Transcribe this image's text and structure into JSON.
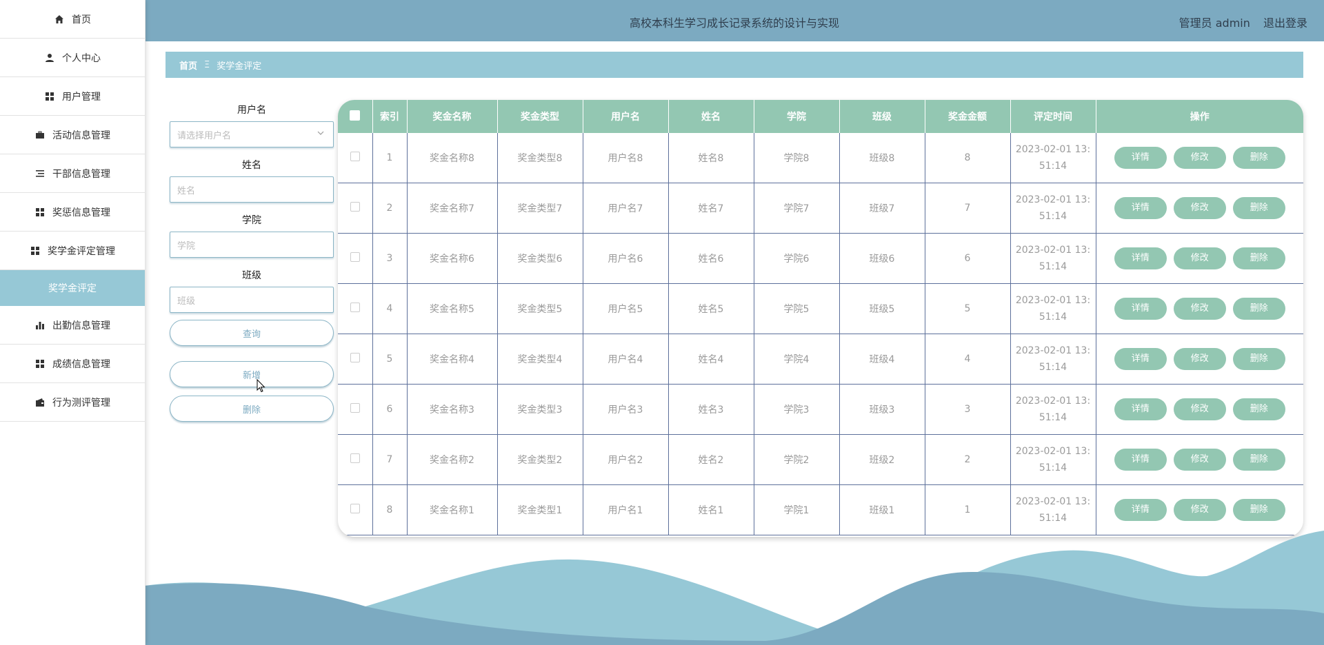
{
  "header": {
    "title": "高校本科生学习成长记录系统的设计与实现",
    "user_label": "管理员 admin",
    "logout": "退出登录"
  },
  "sidebar": {
    "items": [
      {
        "label": "首页",
        "icon": "home-icon"
      },
      {
        "label": "个人中心",
        "icon": "person-icon"
      },
      {
        "label": "用户管理",
        "icon": "grid-icon"
      },
      {
        "label": "活动信息管理",
        "icon": "briefcase-icon"
      },
      {
        "label": "干部信息管理",
        "icon": "list-icon"
      },
      {
        "label": "奖惩信息管理",
        "icon": "grid-icon"
      },
      {
        "label": "奖学金评定管理",
        "icon": "grid-icon"
      },
      {
        "label": "奖学金评定",
        "icon": ""
      },
      {
        "label": "出勤信息管理",
        "icon": "bar-chart-icon"
      },
      {
        "label": "成绩信息管理",
        "icon": "grid-icon"
      },
      {
        "label": "行为测评管理",
        "icon": "wallet-icon"
      }
    ]
  },
  "breadcrumb": {
    "home": "首页",
    "sep": "Ξ",
    "current": "奖学金评定"
  },
  "search": {
    "username_label": "用户名",
    "username_placeholder": "请选择用户名",
    "name_label": "姓名",
    "name_placeholder": "姓名",
    "college_label": "学院",
    "college_placeholder": "学院",
    "class_label": "班级",
    "class_placeholder": "班级",
    "query_button": "查询",
    "add_button": "新增",
    "delete_button": "删除"
  },
  "table": {
    "headers": [
      "索引",
      "奖金名称",
      "奖金类型",
      "用户名",
      "姓名",
      "学院",
      "班级",
      "奖金金额",
      "评定时间",
      "操作"
    ],
    "actions": {
      "detail": "详情",
      "edit": "修改",
      "delete": "删除"
    },
    "rows": [
      {
        "index": "1",
        "award_name": "奖金名称8",
        "award_type": "奖金类型8",
        "username": "用户名8",
        "name": "姓名8",
        "college": "学院8",
        "class": "班级8",
        "amount": "8",
        "time_line1": "2023-02-01 13:",
        "time_line2": "51:14"
      },
      {
        "index": "2",
        "award_name": "奖金名称7",
        "award_type": "奖金类型7",
        "username": "用户名7",
        "name": "姓名7",
        "college": "学院7",
        "class": "班级7",
        "amount": "7",
        "time_line1": "2023-02-01 13:",
        "time_line2": "51:14"
      },
      {
        "index": "3",
        "award_name": "奖金名称6",
        "award_type": "奖金类型6",
        "username": "用户名6",
        "name": "姓名6",
        "college": "学院6",
        "class": "班级6",
        "amount": "6",
        "time_line1": "2023-02-01 13:",
        "time_line2": "51:14"
      },
      {
        "index": "4",
        "award_name": "奖金名称5",
        "award_type": "奖金类型5",
        "username": "用户名5",
        "name": "姓名5",
        "college": "学院5",
        "class": "班级5",
        "amount": "5",
        "time_line1": "2023-02-01 13:",
        "time_line2": "51:14"
      },
      {
        "index": "5",
        "award_name": "奖金名称4",
        "award_type": "奖金类型4",
        "username": "用户名4",
        "name": "姓名4",
        "college": "学院4",
        "class": "班级4",
        "amount": "4",
        "time_line1": "2023-02-01 13:",
        "time_line2": "51:14"
      },
      {
        "index": "6",
        "award_name": "奖金名称3",
        "award_type": "奖金类型3",
        "username": "用户名3",
        "name": "姓名3",
        "college": "学院3",
        "class": "班级3",
        "amount": "3",
        "time_line1": "2023-02-01 13:",
        "time_line2": "51:14"
      },
      {
        "index": "7",
        "award_name": "奖金名称2",
        "award_type": "奖金类型2",
        "username": "用户名2",
        "name": "姓名2",
        "college": "学院2",
        "class": "班级2",
        "amount": "2",
        "time_line1": "2023-02-01 13:",
        "time_line2": "51:14"
      },
      {
        "index": "8",
        "award_name": "奖金名称1",
        "award_type": "奖金类型1",
        "username": "用户名1",
        "name": "姓名1",
        "college": "学院1",
        "class": "班级1",
        "amount": "1",
        "time_line1": "2023-02-01 13:",
        "time_line2": "51:14"
      }
    ]
  },
  "colors": {
    "header_bg": "#7caac1",
    "accent_light": "#96c8d6",
    "table_header": "#93c7b2",
    "button_green": "#93c7b2"
  }
}
